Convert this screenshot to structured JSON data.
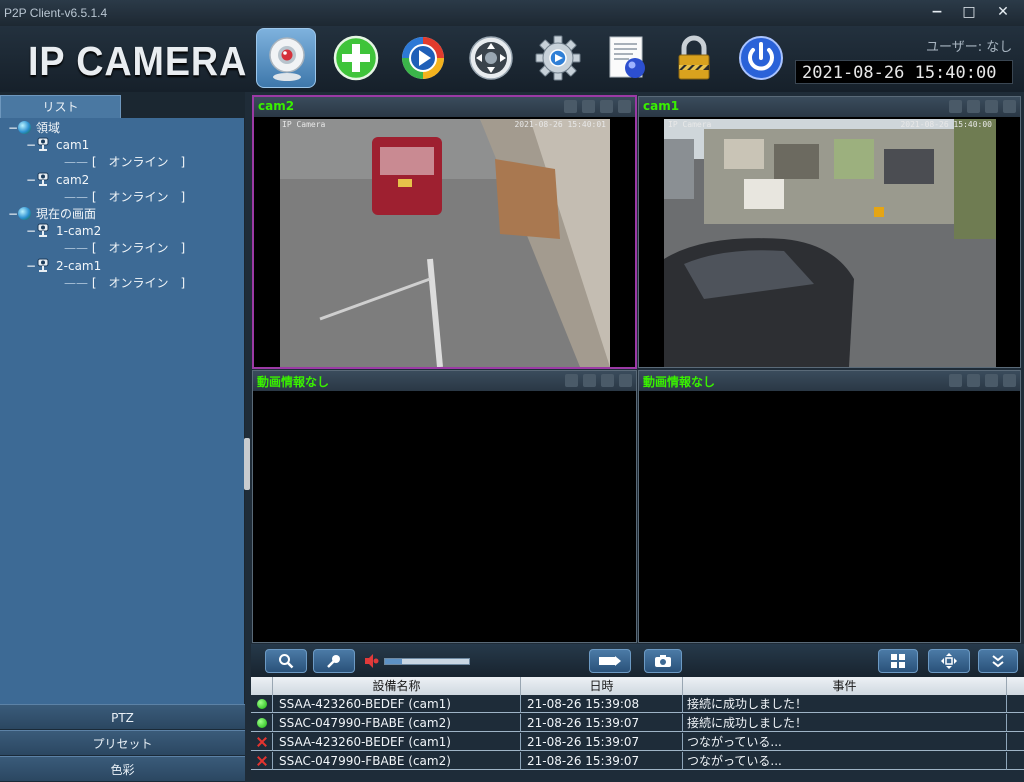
{
  "window": {
    "title": "P2P Client-v6.5.1.4",
    "minimize": "−",
    "maximize": "□",
    "close": "✕"
  },
  "header": {
    "logo": "IP CAMERA",
    "user": "ユーザー: なし",
    "clock": "2021-08-26 15:40:00",
    "toolbar": [
      "camera-monitor",
      "add-device",
      "playback",
      "ptz-control",
      "settings",
      "log",
      "lock",
      "power"
    ]
  },
  "sidebar": {
    "tab": "リスト",
    "tree": [
      {
        "label": "領域",
        "level": 0,
        "type": "group"
      },
      {
        "label": "cam1",
        "level": 1,
        "type": "camera"
      },
      {
        "label": "[　オンライン　]",
        "level": 2,
        "type": "status"
      },
      {
        "label": "cam2",
        "level": 1,
        "type": "camera"
      },
      {
        "label": "[　オンライン　]",
        "level": 2,
        "type": "status"
      },
      {
        "label": "現在の画面",
        "level": 0,
        "type": "group"
      },
      {
        "label": "1-cam2",
        "level": 1,
        "type": "camera"
      },
      {
        "label": "[　オンライン　]",
        "level": 2,
        "type": "status"
      },
      {
        "label": "2-cam1",
        "level": 1,
        "type": "camera"
      },
      {
        "label": "[　オンライン　]",
        "level": 2,
        "type": "status"
      }
    ],
    "bottom_buttons": [
      "PTZ",
      "プリセット",
      "色彩"
    ]
  },
  "panes": [
    {
      "title": "cam2",
      "selected": true,
      "osd_left": "IP Camera",
      "osd_right": "2021-08-26 15:40:01"
    },
    {
      "title": "cam1",
      "selected": false,
      "osd_left": "IP Camera",
      "osd_right": "2021-08-26 15:40:00"
    },
    {
      "title": "動画情報なし",
      "selected": false
    },
    {
      "title": "動画情報なし",
      "selected": false
    }
  ],
  "controls": {
    "volume": 0.2
  },
  "log": {
    "columns": [
      "",
      "設備名称",
      "日時",
      "事件",
      ""
    ],
    "rows": [
      {
        "status": "ok",
        "device": "SSAA-423260-BEDEF (cam1)",
        "time": "21-08-26 15:39:08",
        "event": "接続に成功しました！"
      },
      {
        "status": "ok",
        "device": "SSAC-047990-FBABE (cam2)",
        "time": "21-08-26 15:39:07",
        "event": "接続に成功しました！"
      },
      {
        "status": "err",
        "device": "SSAA-423260-BEDEF (cam1)",
        "time": "21-08-26 15:39:07",
        "event": "つながっている..."
      },
      {
        "status": "err",
        "device": "SSAC-047990-FBABE (cam2)",
        "time": "21-08-26 15:39:07",
        "event": "つながっている..."
      }
    ]
  },
  "colors": {
    "accent": "#39f000",
    "selected_border": "#9b3aa5",
    "sidebar": "#3d6a95"
  }
}
